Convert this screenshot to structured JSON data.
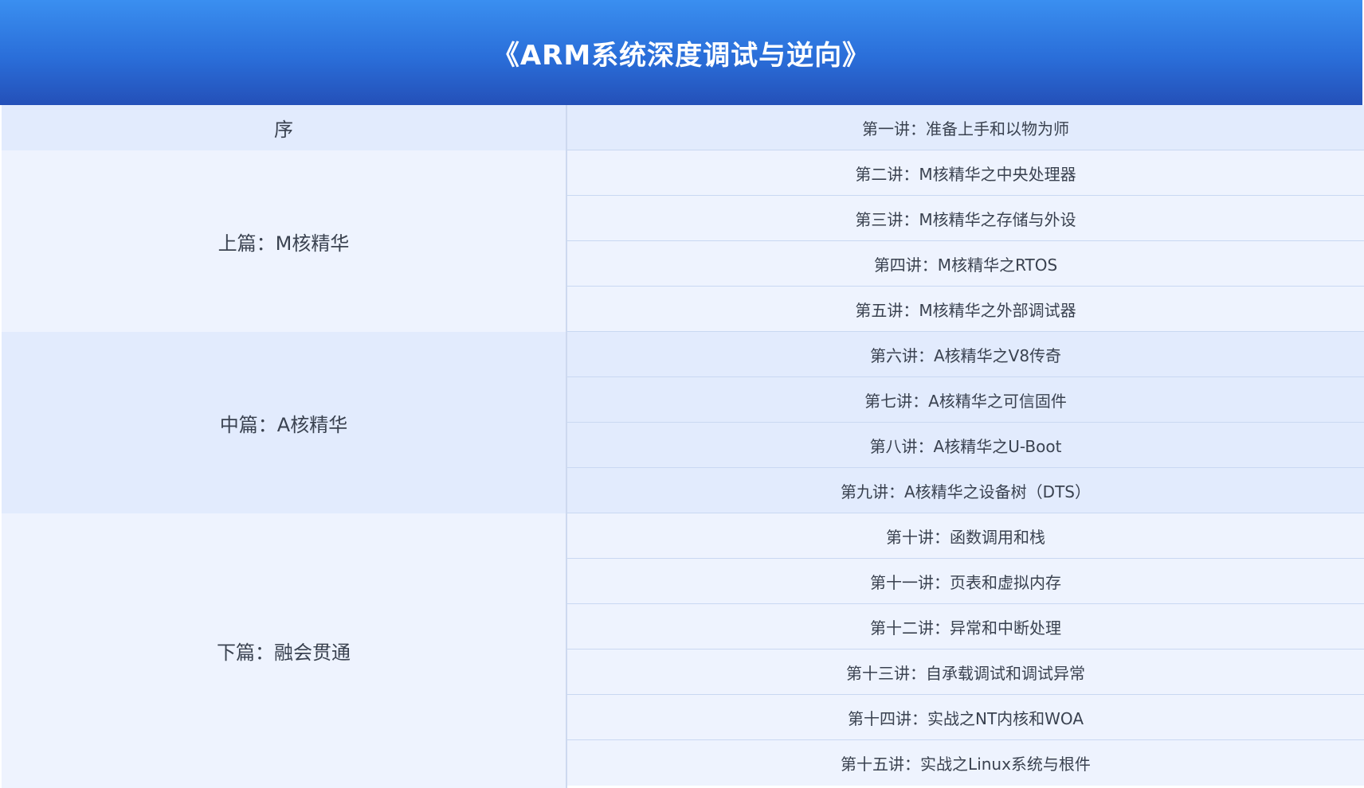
{
  "header": {
    "title": "《ARM系统深度调试与逆向》"
  },
  "sections": [
    {
      "label": "序",
      "rows": 1
    },
    {
      "label": "上篇：M核精华",
      "rows": 4
    },
    {
      "label": "中篇：A核精华",
      "rows": 4
    },
    {
      "label": "下篇：融会贯通",
      "rows": 6
    }
  ],
  "lectures": [
    "第一讲：准备上手和以物为师",
    "第二讲：M核精华之中央处理器",
    "第三讲：M核精华之存储与外设",
    "第四讲：M核精华之RTOS",
    "第五讲：M核精华之外部调试器",
    "第六讲：A核精华之V8传奇",
    "第七讲：A核精华之可信固件",
    "第八讲：A核精华之U-Boot",
    "第九讲：A核精华之设备树（DTS）",
    "第十讲：函数调用和栈",
    "第十一讲：页表和虚拟内存",
    "第十二讲：异常和中断处理",
    "第十三讲：自承载调试和调试异常",
    "第十四讲：实战之NT内核和WOA",
    "第十五讲：实战之Linux系统与根件"
  ]
}
